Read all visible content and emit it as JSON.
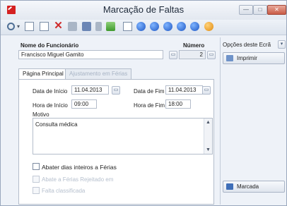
{
  "window": {
    "title": "Marcação de Faltas",
    "controls": {
      "minimize": "—",
      "maximize": "□",
      "close": "✕"
    }
  },
  "toolbar": {
    "icons": [
      "search-icon",
      "new-document-icon",
      "copy-document-icon",
      "delete-icon",
      "edit-icon",
      "list-icon",
      "export-icon",
      "chart-icon",
      "zoom-icon",
      "first-record-icon",
      "previous-record-icon",
      "next-record-icon",
      "last-record-icon",
      "refresh-icon"
    ]
  },
  "header": {
    "employee_label": "Nome do Funcionário",
    "employee_value": "Francisco Miguel Gamito",
    "number_label": "Número",
    "number_value": "2"
  },
  "tabs": [
    {
      "label": "Página Principal",
      "active": true
    },
    {
      "label": "Ajustamento em Férias",
      "active": false
    }
  ],
  "form": {
    "start_date_label": "Data de Início",
    "start_date_value": "11.04.2013",
    "end_date_label": "Data de Fim",
    "end_date_value": "11.04.2013",
    "start_time_label": "Hora de Início",
    "start_time_value": "09:00",
    "end_time_label": "Hora de Fim",
    "end_time_value": "18:00",
    "reason_label": "Motivo",
    "reason_value": "Consulta médica",
    "checkboxes": [
      {
        "label": "Abater dias inteiros a Férias",
        "enabled": true,
        "checked": false
      },
      {
        "label": "Abate a Férias Rejeitado em",
        "enabled": false,
        "checked": false
      },
      {
        "label": "Falta classificada",
        "enabled": false,
        "checked": false
      }
    ]
  },
  "side_panel": {
    "options_label": "Opções deste Ecrã",
    "print_button": "Imprimir",
    "marked_button": "Marcada"
  },
  "colors": {
    "accent": "#1f58c4",
    "close": "#c95b45",
    "app_icon": "#d42020"
  }
}
